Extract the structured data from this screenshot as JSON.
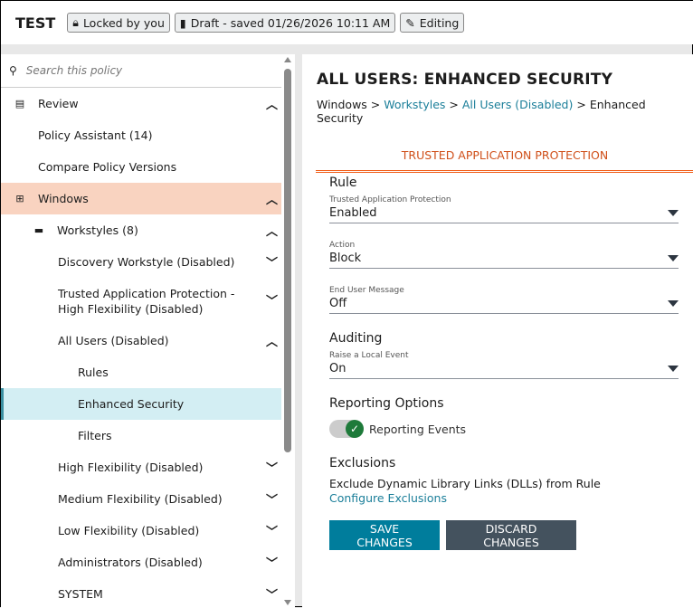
{
  "header": {
    "title": "TEST",
    "locked": "Locked by you",
    "draft": "Draft - saved 01/26/2026 10:11 AM",
    "editing": "Editing"
  },
  "sidebar": {
    "search_placeholder": "Search this policy",
    "items": [
      {
        "label": "Review",
        "icon": "clipboard-icon",
        "chev": "up"
      },
      {
        "label": "Policy Assistant (14)"
      },
      {
        "label": "Compare Policy Versions"
      },
      {
        "label": "Windows",
        "icon": "windows-icon",
        "chev": "up"
      },
      {
        "label": "Workstyles (8)",
        "icon": "briefcase-icon",
        "chev": "up"
      },
      {
        "label": "Discovery Workstyle (Disabled)",
        "chev": "down"
      },
      {
        "label": "Trusted Application Protection - High Flexibility (Disabled)",
        "chev": "down"
      },
      {
        "label": "All Users (Disabled)",
        "chev": "up"
      },
      {
        "label": "Rules"
      },
      {
        "label": "Enhanced Security"
      },
      {
        "label": "Filters"
      },
      {
        "label": "High Flexibility (Disabled)",
        "chev": "down"
      },
      {
        "label": "Medium Flexibility (Disabled)",
        "chev": "down"
      },
      {
        "label": "Low Flexibility (Disabled)",
        "chev": "down"
      },
      {
        "label": "Administrators (Disabled)",
        "chev": "down"
      },
      {
        "label": "SYSTEM",
        "chev": "down"
      }
    ]
  },
  "main": {
    "title": "ALL USERS: ENHANCED SECURITY",
    "breadcrumb": [
      "Windows",
      "Workstyles",
      "All Users (Disabled)",
      "Enhanced Security"
    ],
    "sep": ">",
    "tab": "TRUSTED APPLICATION PROTECTION",
    "rule_heading": "Rule",
    "fields": [
      {
        "label": "Trusted Application Protection",
        "value": "Enabled"
      },
      {
        "label": "Action",
        "value": "Block"
      },
      {
        "label": "End User Message",
        "value": "Off"
      },
      {
        "label": "Raise a Local Event",
        "value": "On"
      }
    ],
    "auditing_heading": "Auditing",
    "reporting_heading": "Reporting Options",
    "reporting_toggle": "Reporting Events",
    "exclusions_heading": "Exclusions",
    "exclusions_text": "Exclude Dynamic Library Links (DLLs) from Rule",
    "configure_link": "Configure Exclusions",
    "save": "SAVE CHANGES",
    "discard": "DISCARD CHANGES"
  },
  "colors": {
    "accent": "#007d9c",
    "orange": "#f05a14",
    "selected": "#d3eef3",
    "windows": "#f9d3c0"
  }
}
